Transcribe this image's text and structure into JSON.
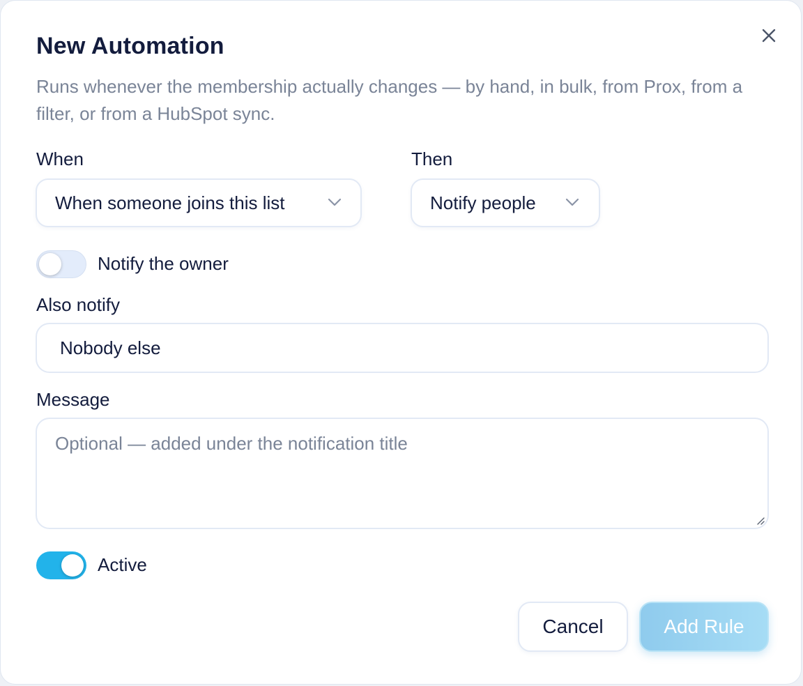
{
  "dialog": {
    "title": "New Automation",
    "subtitle": "Runs whenever the membership actually changes — by hand, in bulk, from Prox, from a filter, or from a HubSpot sync."
  },
  "trigger": {
    "label": "When",
    "selected": "When someone joins this list"
  },
  "action": {
    "label": "Then",
    "selected": "Notify people"
  },
  "notify_owner": {
    "label": "Notify the owner",
    "enabled": false
  },
  "also_notify": {
    "label": "Also notify",
    "value": "Nobody else"
  },
  "message": {
    "label": "Message",
    "placeholder": "Optional — added under the notification title"
  },
  "active": {
    "label": "Active",
    "enabled": true
  },
  "footer": {
    "cancel_label": "Cancel",
    "submit_label": "Add Rule"
  },
  "icons": {
    "close": "close-icon",
    "chevron": "chevron-down-icon",
    "resize": "resize-handle-icon"
  },
  "colors": {
    "accent": "#22b3ea",
    "text": "#131c3d",
    "muted": "#7a8497",
    "border": "#e2e9f5"
  }
}
